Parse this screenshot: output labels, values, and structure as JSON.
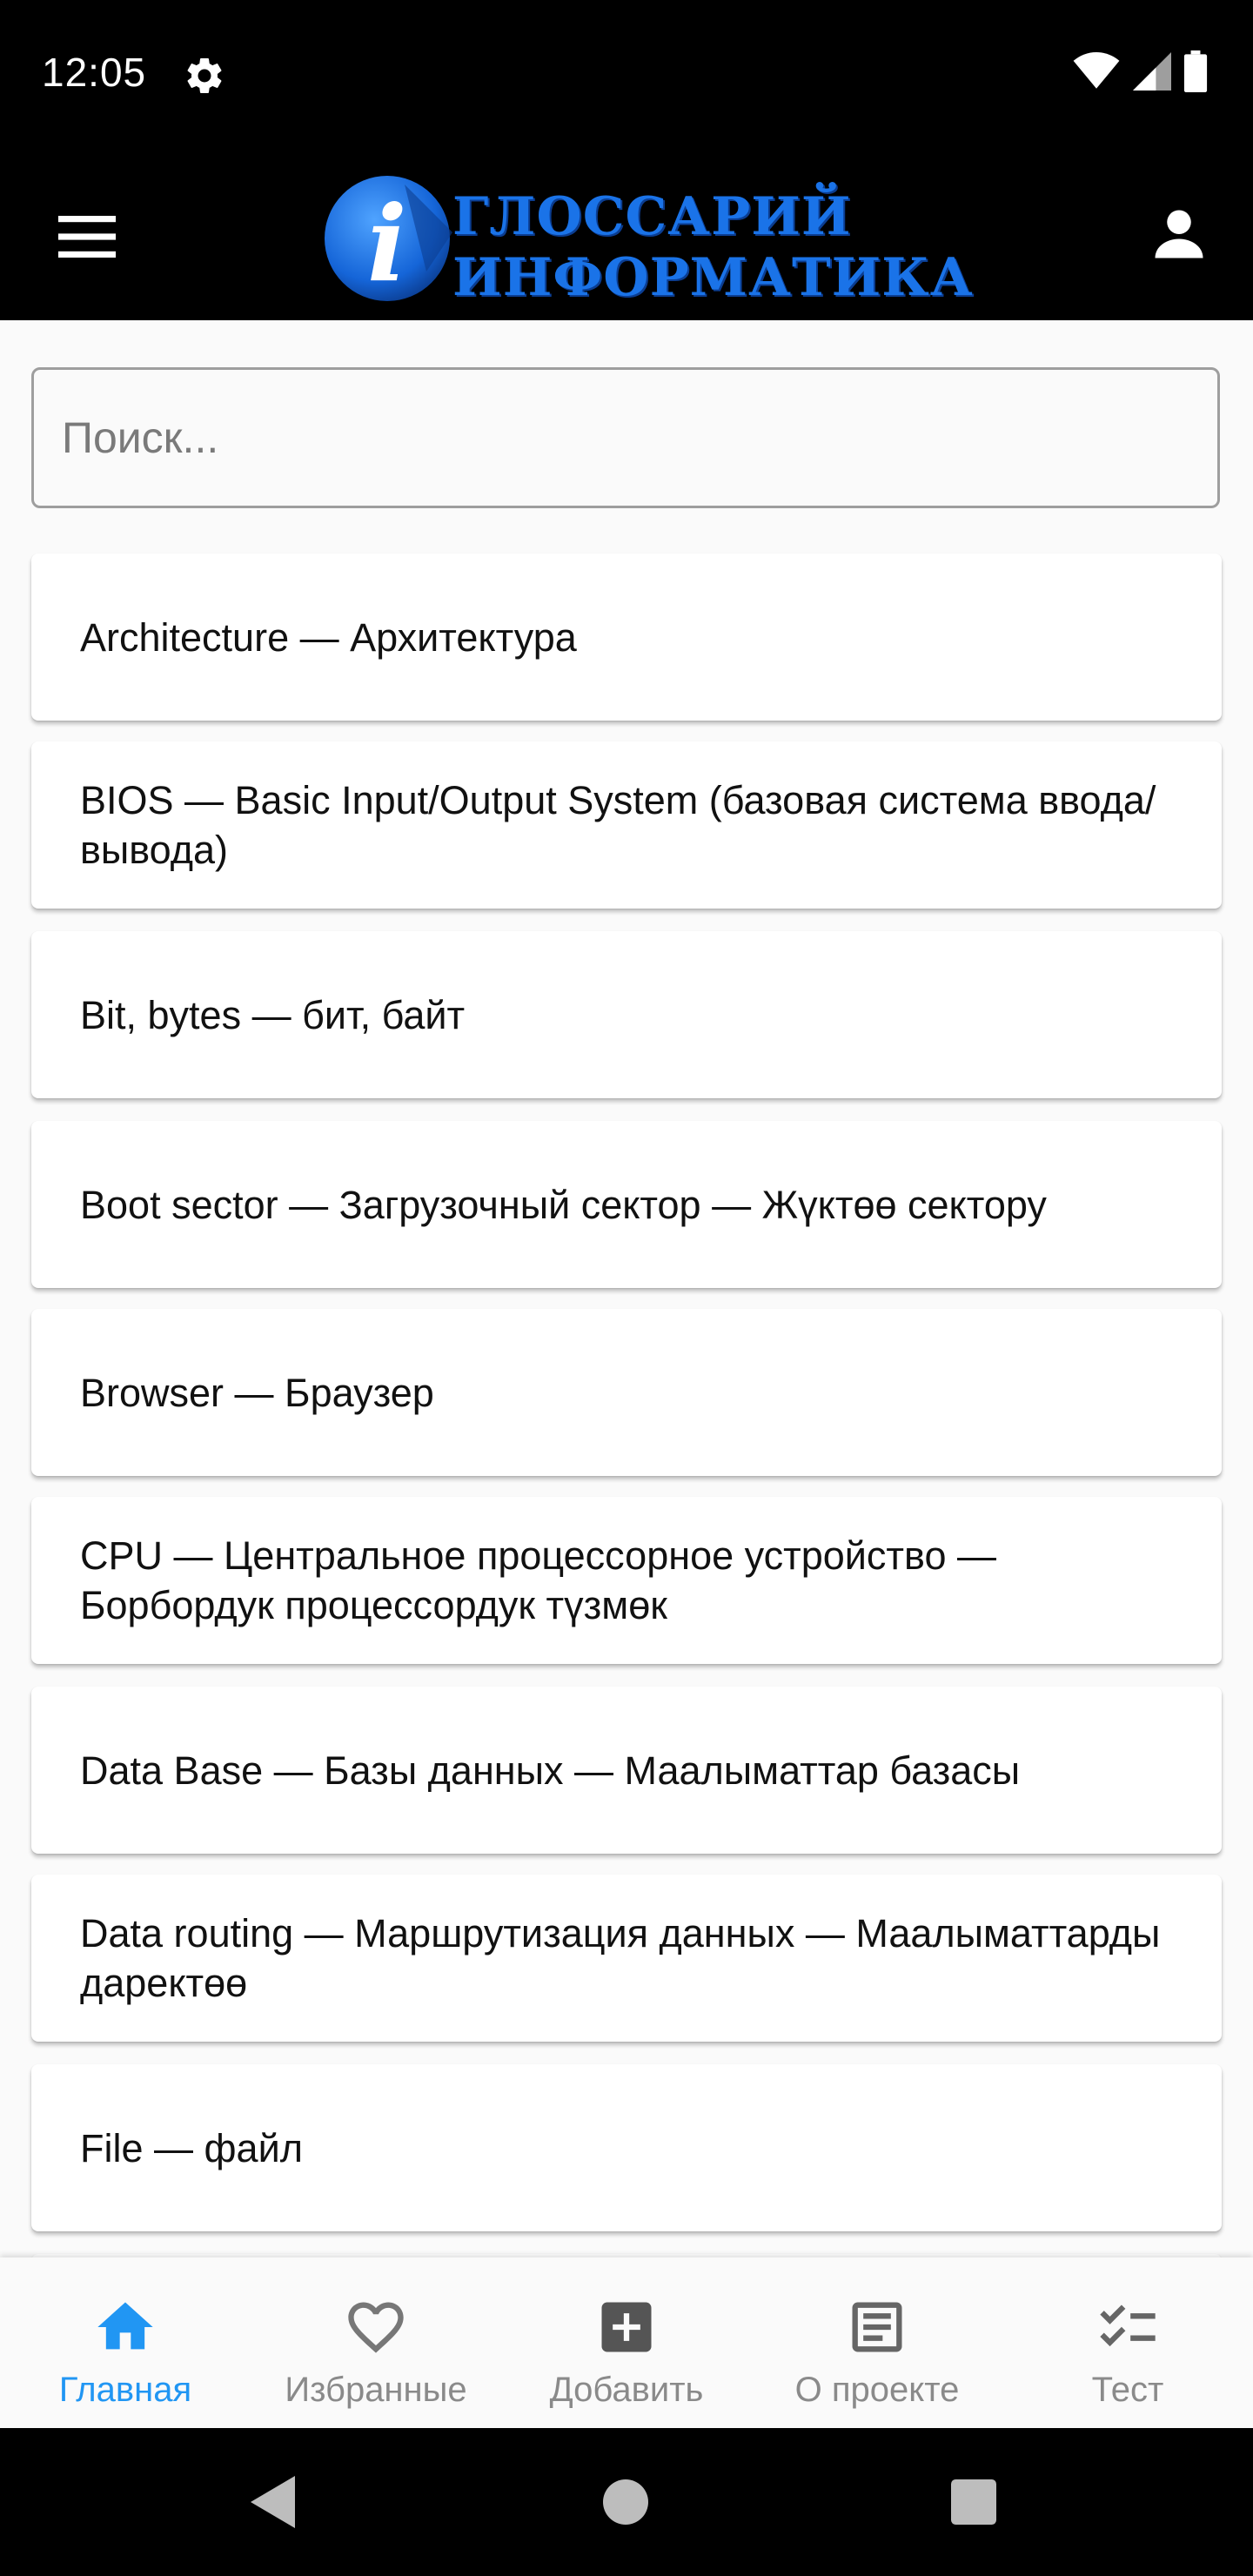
{
  "status_bar": {
    "time": "12:05",
    "icons": [
      "settings-icon",
      "wifi-icon",
      "signal-icon",
      "battery-icon"
    ]
  },
  "app_bar": {
    "logo_line1": "ГЛОССАРИЙ",
    "logo_line2": "ИНФОРМАТИКА",
    "logo_letter": "i",
    "icons": [
      "menu-icon",
      "account-icon"
    ]
  },
  "search": {
    "placeholder": "Поиск...",
    "value": ""
  },
  "terms": [
    {
      "label": "Architecture — Архитектура"
    },
    {
      "label": "BIOS — Basic Input/Output System (базовая система ввода/вывода)"
    },
    {
      "label": "Bit, bytes — бит, байт"
    },
    {
      "label": "Boot sector — Загрузочный сектор — Жүктөө сектору"
    },
    {
      "label": "Browser — Браузер"
    },
    {
      "label": "CPU — Центральное процессорное устройство — Борбордук процессордук түзмөк"
    },
    {
      "label": "Data Base — Базы данных — Маалыматтар базасы"
    },
    {
      "label": "Data routing — Маршрутизация данных — Маалыматтарды даректөө"
    },
    {
      "label": "File — файл"
    }
  ],
  "bottom_nav": {
    "items": [
      {
        "label": "Главная",
        "icon": "home-icon",
        "active": true
      },
      {
        "label": "Избранные",
        "icon": "heart-icon",
        "active": false
      },
      {
        "label": "Добавить",
        "icon": "add-box-icon",
        "active": false
      },
      {
        "label": "О проекте",
        "icon": "document-icon",
        "active": false
      },
      {
        "label": "Тест",
        "icon": "checklist-icon",
        "active": false
      }
    ]
  },
  "colors": {
    "accent": "#2196f3",
    "logo_blue": "#1a73e8",
    "inactive": "#8a8a8a",
    "bar": "#000000"
  }
}
